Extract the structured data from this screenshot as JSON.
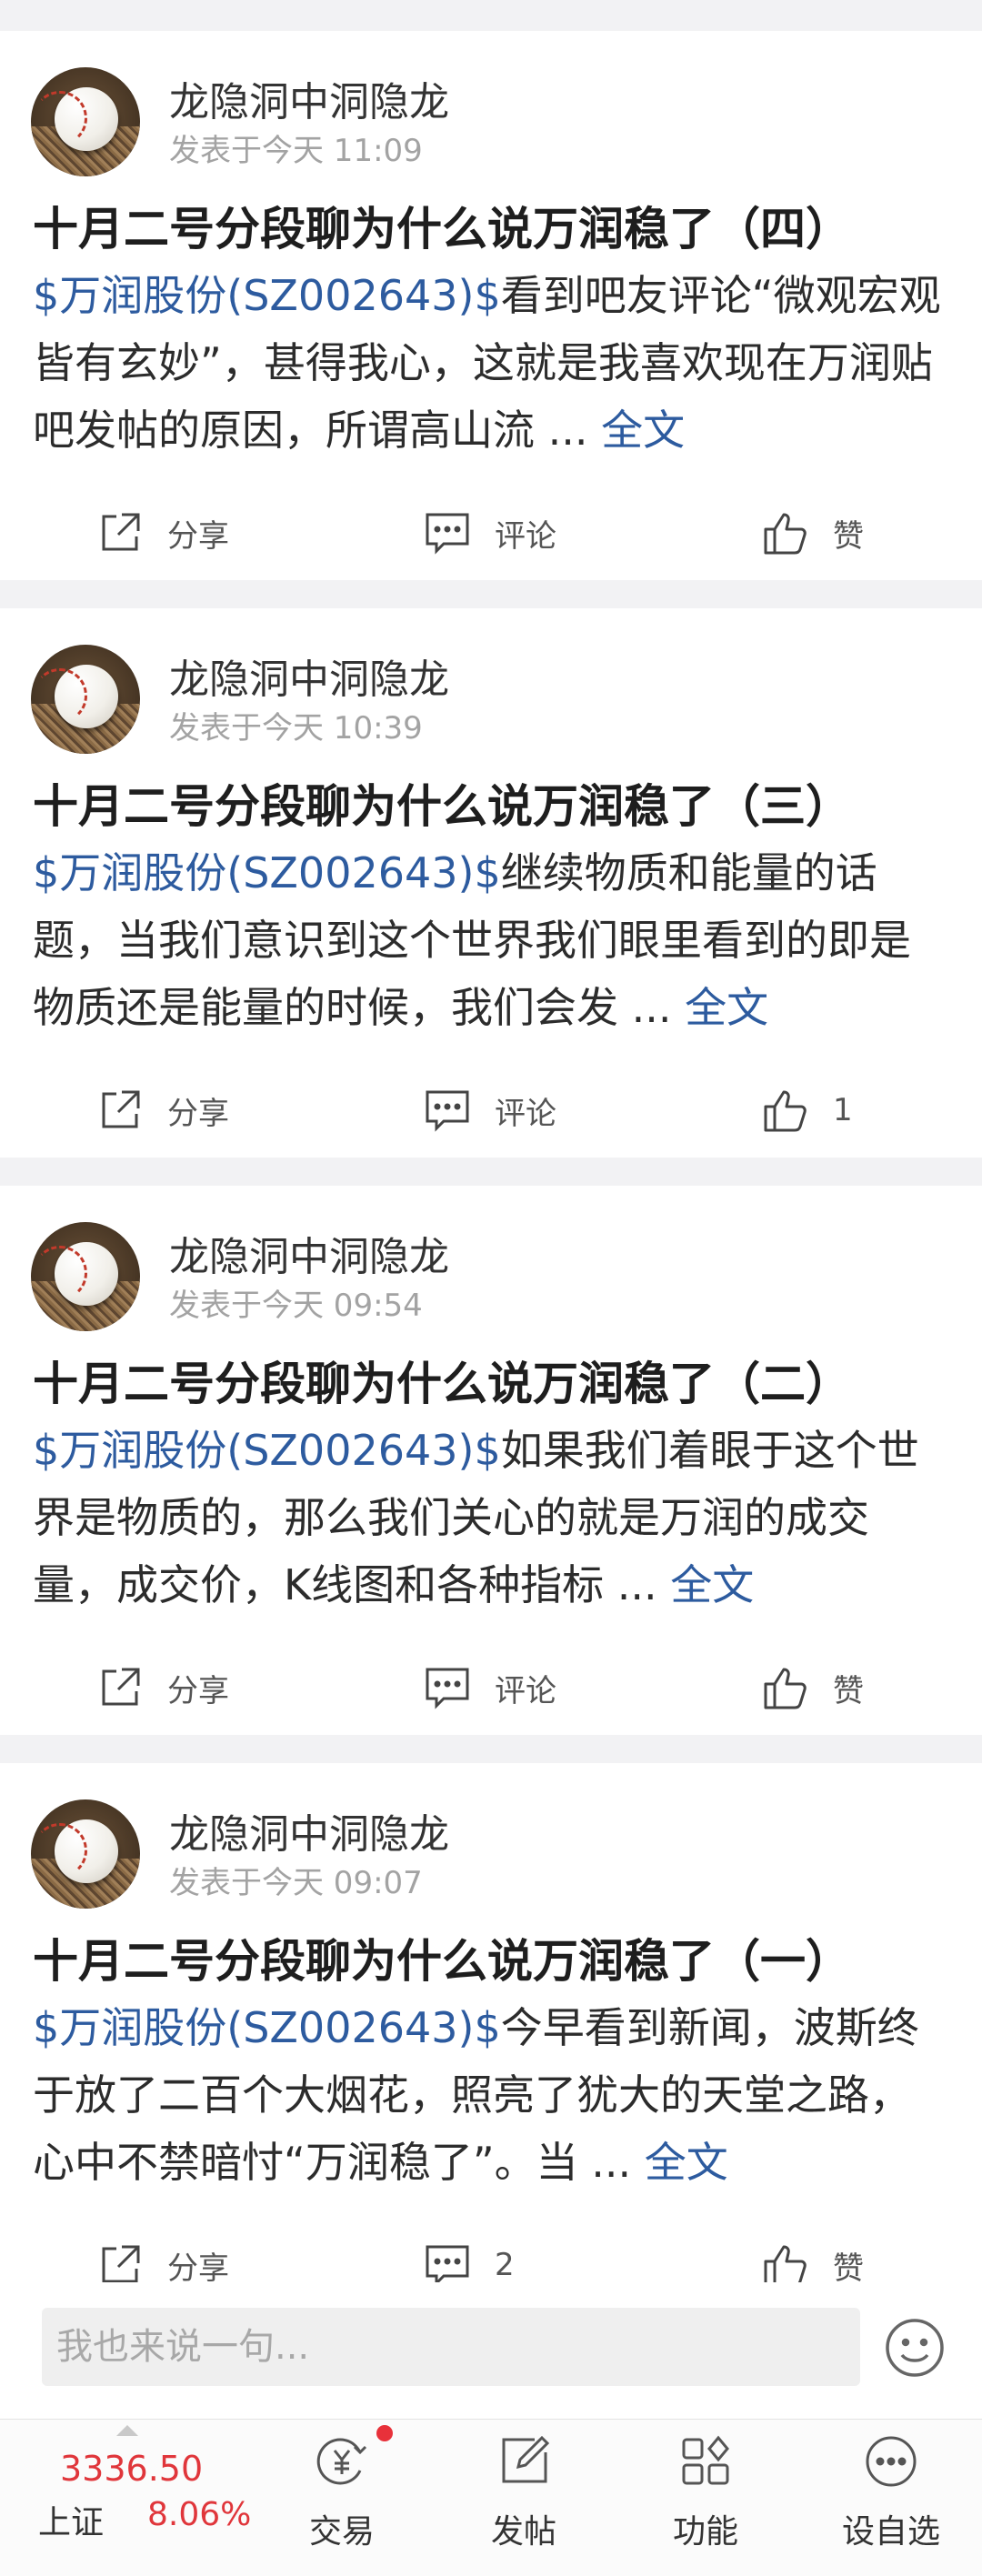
{
  "posts": [
    {
      "author": "龙隐洞中洞隐龙",
      "time": "发表于今天 11:09",
      "title": "十月二号分段聊为什么说万润稳了（四）",
      "stock_tag": "$万润股份(SZ002643)$",
      "excerpt": "看到吧友评论“微观宏观皆有玄妙”，甚得我心，这就是我喜欢现在万润贴吧发帖的原因，所谓高山流 ...",
      "more": "全文",
      "share_label": "分享",
      "comment_label": "评论",
      "like_label": "赞"
    },
    {
      "author": "龙隐洞中洞隐龙",
      "time": "发表于今天 10:39",
      "title": "十月二号分段聊为什么说万润稳了（三）",
      "stock_tag": "$万润股份(SZ002643)$",
      "excerpt": "继续物质和能量的话题，当我们意识到这个世界我们眼里看到的即是物质还是能量的时候，我们会发 ...",
      "more": "全文",
      "share_label": "分享",
      "comment_label": "评论",
      "like_label": "1"
    },
    {
      "author": "龙隐洞中洞隐龙",
      "time": "发表于今天 09:54",
      "title": "十月二号分段聊为什么说万润稳了（二）",
      "stock_tag": "$万润股份(SZ002643)$",
      "excerpt": "如果我们着眼于这个世界是物质的，那么我们关心的就是万润的成交量，成交价，K线图和各种指标 ...",
      "more": "全文",
      "share_label": "分享",
      "comment_label": "评论",
      "like_label": "赞"
    },
    {
      "author": "龙隐洞中洞隐龙",
      "time": "发表于今天 09:07",
      "title": "十月二号分段聊为什么说万润稳了（一）",
      "stock_tag": "$万润股份(SZ002643)$",
      "excerpt": "今早看到新闻，波斯终于放了二百个大烟花，照亮了犹大的天堂之路，心中不禁暗忖“万润稳了”。当 ...",
      "more": "全文",
      "share_label": "分享",
      "comment_label": "2",
      "like_label": "赞"
    }
  ],
  "comment_bar": {
    "placeholder": "我也来说一句..."
  },
  "tabbar": {
    "index_value": "3336.50",
    "index_name": "上证",
    "index_change": "8.06%",
    "tabs": [
      {
        "label": "交易",
        "icon": "yen-coin-icon"
      },
      {
        "label": "发帖",
        "icon": "compose-icon"
      },
      {
        "label": "功能",
        "icon": "grid-icon"
      },
      {
        "label": "设自选",
        "icon": "more-dots-icon"
      }
    ]
  },
  "colors": {
    "link_blue": "#2d5b9f",
    "index_red": "#e0363b",
    "background": "#f2f2f4"
  }
}
